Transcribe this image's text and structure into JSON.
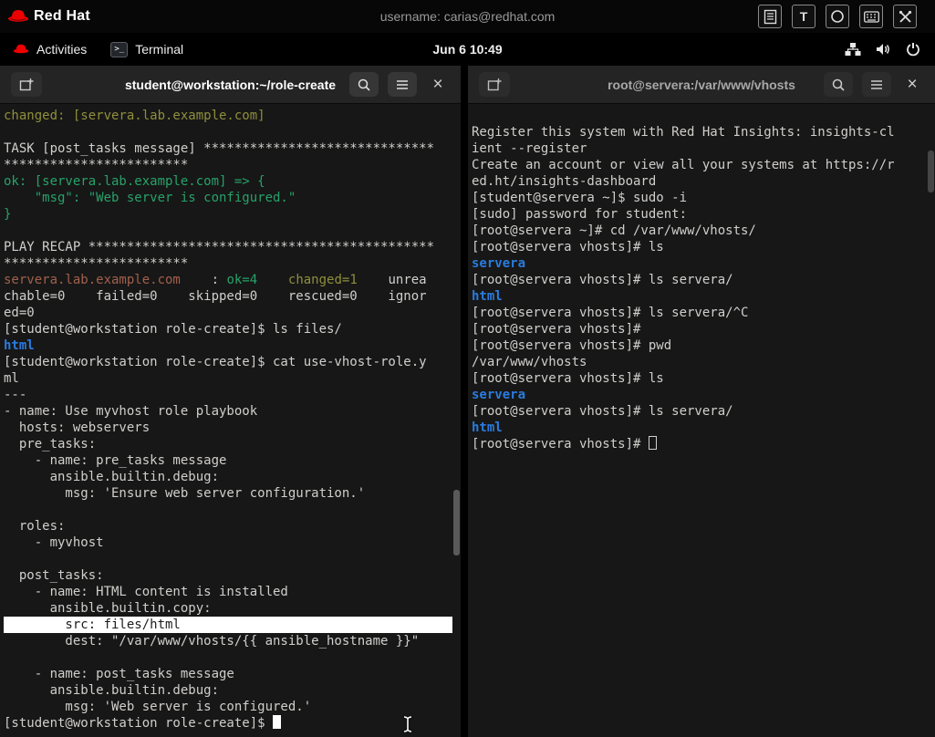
{
  "colors": {
    "topbar_bg": "#070707",
    "terminal_bg": "#171717",
    "terminal_fg": "#d0cfcc",
    "header_bg": "#242424",
    "green": "#26a269",
    "olive": "#8f8f3c",
    "rust": "#a2604c",
    "blue": "#2a7bde",
    "selection_bg": "#ffffff",
    "selection_fg": "#1c1c1c",
    "title_focused": "#ffffff",
    "title_unfocused": "#a8a8a8",
    "accent_red": "#ee0000"
  },
  "top_bar": {
    "logo_text": "Red Hat",
    "username": "username: carias@redhat.com",
    "tray_icons": [
      "clipboard-icon",
      "text-tool-icon",
      "record-icon",
      "keyboard-icon",
      "tools-icon"
    ],
    "tray_text_icon_label": "T"
  },
  "shell_bar": {
    "activities_label": "Activities",
    "app_label": "Terminal",
    "clock": "Jun 6 10:49",
    "status_icons": [
      "network-icon",
      "volume-icon",
      "power-icon"
    ]
  },
  "left_window": {
    "title": "student@workstation:~/role-create",
    "header_icons": [
      "new-tab-icon",
      "search-icon",
      "menu-icon",
      "close-icon"
    ],
    "close_glyph": "×",
    "lines": [
      {
        "segs": [
          {
            "t": "changed: [servera.lab.example.com]",
            "c": "olive"
          }
        ]
      },
      "",
      "TASK [post_tasks message] ******************************",
      "************************",
      {
        "segs": [
          {
            "t": "ok: [servera.lab.example.com] => {",
            "c": "green"
          }
        ]
      },
      {
        "segs": [
          {
            "t": "    \"msg\": \"Web server is configured.\"",
            "c": "green"
          }
        ]
      },
      {
        "segs": [
          {
            "t": "}",
            "c": "green"
          }
        ]
      },
      "",
      "PLAY RECAP *********************************************",
      "************************",
      {
        "segs": [
          {
            "t": "servera.lab.example.com",
            "c": "rust"
          },
          {
            "t": "    : "
          },
          {
            "t": "ok=4",
            "c": "green"
          },
          {
            "t": "    "
          },
          {
            "t": "changed=1",
            "c": "olive"
          },
          {
            "t": "    unrea"
          }
        ]
      },
      "chable=0    failed=0    skipped=0    rescued=0    ignor",
      "ed=0",
      "[student@workstation role-create]$ ls files/",
      {
        "segs": [
          {
            "t": "html",
            "c": "blue"
          }
        ]
      },
      "[student@workstation role-create]$ cat use-vhost-role.y",
      "ml",
      "---",
      "- name: Use myvhost role playbook",
      "  hosts: webservers",
      "  pre_tasks:",
      "    - name: pre_tasks message",
      "      ansible.builtin.debug:",
      "        msg: 'Ensure web server configuration.'",
      "",
      "  roles:",
      "    - myvhost",
      "",
      "  post_tasks:",
      "    - name: HTML content is installed",
      "      ansible.builtin.copy:",
      {
        "sel": true,
        "segs": [
          {
            "t": "        src: files/html"
          }
        ]
      },
      "        dest: \"/var/www/vhosts/{{ ansible_hostname }}\"",
      "",
      "    - name: post_tasks message",
      "      ansible.builtin.debug:",
      "        msg: 'Web server is configured.'",
      {
        "segs": [
          {
            "t": "[student@workstation role-create]$ "
          }
        ],
        "cursor": "block"
      }
    ]
  },
  "right_window": {
    "title": "root@servera:/var/www/vhosts",
    "header_icons": [
      "new-tab-icon",
      "search-icon",
      "menu-icon",
      "close-icon"
    ],
    "close_glyph": "×",
    "lines": [
      "",
      "Register this system with Red Hat Insights: insights-cl",
      "ient --register",
      "Create an account or view all your systems at https://r",
      "ed.ht/insights-dashboard",
      "[student@servera ~]$ sudo -i",
      "[sudo] password for student:",
      "[root@servera ~]# cd /var/www/vhosts/",
      "[root@servera vhosts]# ls",
      {
        "segs": [
          {
            "t": "servera",
            "c": "blue"
          }
        ]
      },
      "[root@servera vhosts]# ls servera/",
      {
        "segs": [
          {
            "t": "html",
            "c": "blue"
          }
        ]
      },
      "[root@servera vhosts]# ls servera/^C",
      "[root@servera vhosts]#",
      "[root@servera vhosts]# pwd",
      "/var/www/vhosts",
      "[root@servera vhosts]# ls",
      {
        "segs": [
          {
            "t": "servera",
            "c": "blue"
          }
        ]
      },
      "[root@servera vhosts]# ls servera/",
      {
        "segs": [
          {
            "t": "html",
            "c": "blue"
          }
        ]
      },
      {
        "segs": [
          {
            "t": "[root@servera vhosts]# "
          }
        ],
        "cursor": "hollow"
      }
    ]
  }
}
